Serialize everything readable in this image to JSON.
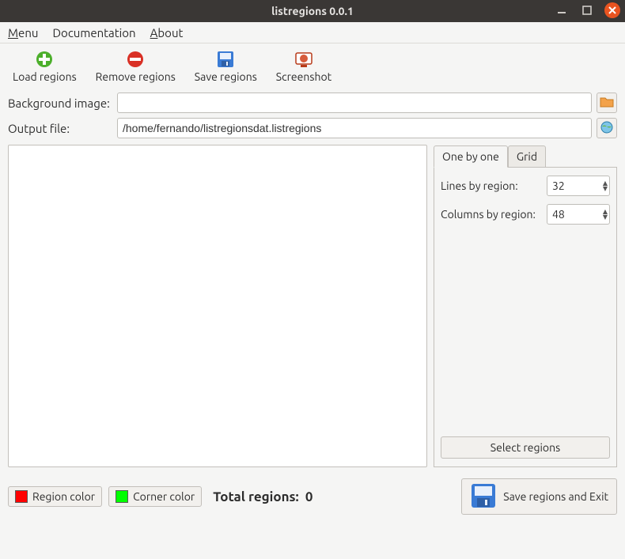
{
  "titlebar": {
    "title": "listregions 0.0.1"
  },
  "menubar": {
    "menu": "Menu",
    "menu_underline": "M",
    "documentation": "Documentation",
    "about": "About",
    "about_underline": "A"
  },
  "toolbar": {
    "load": "Load regions",
    "remove": "Remove regions",
    "save": "Save regions",
    "screenshot": "Screenshot"
  },
  "form": {
    "bg_label": "Background image:",
    "bg_value": "",
    "out_label": "Output file:",
    "out_value": "/home/fernando/listregionsdat.listregions"
  },
  "tabs": {
    "one": "One by one",
    "grid": "Grid"
  },
  "side": {
    "lines_label": "Lines by region:",
    "lines_value": "32",
    "cols_label": "Columns by region:",
    "cols_value": "48",
    "select": "Select regions"
  },
  "footer": {
    "region_color_label": "Region color",
    "region_color": "#ff0000",
    "corner_color_label": "Corner color",
    "corner_color": "#00ff00",
    "total_label": "Total regions:",
    "total_value": "0",
    "save_exit": "Save regions and Exit"
  }
}
